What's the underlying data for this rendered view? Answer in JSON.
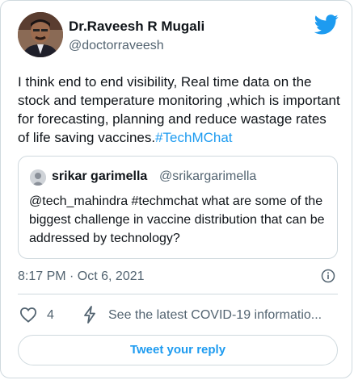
{
  "author": {
    "name": "Dr.Raveesh R Mugali",
    "handle": "@doctorraveesh"
  },
  "tweet": {
    "text": "I think end to end visibility, Real time data on the stock and temperature monitoring ,which is important for forecasting, planning and reduce wastage rates of life saving vaccines.",
    "hashtag": "#TechMChat"
  },
  "quote": {
    "name": "srikar garimella",
    "handle": "@srikargarimella",
    "text": "@tech_mahindra #techmchat what are some of the biggest challenge in vaccine distribution that can be addressed by technology?"
  },
  "meta": {
    "timestamp": "8:17 PM · Oct 6, 2021"
  },
  "actions": {
    "like_count": "4",
    "covid_info": "See the latest COVID-19 informatio..."
  },
  "reply_button": "Tweet your reply",
  "colors": {
    "accent": "#1d9bf0",
    "text": "#0f1419",
    "secondary": "#536471",
    "border": "#cfd9de"
  },
  "icons": [
    "twitter-bird-icon",
    "info-icon",
    "heart-icon",
    "bolt-icon"
  ]
}
